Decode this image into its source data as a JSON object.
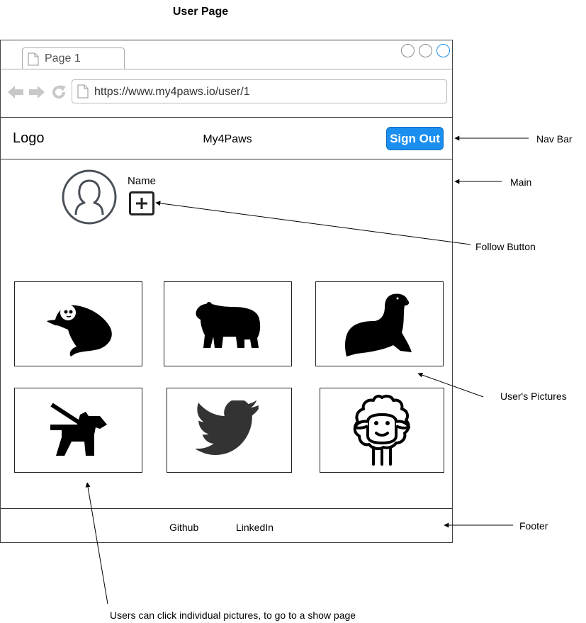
{
  "page_title": "User Page",
  "browser": {
    "tab_label": "Page 1",
    "url": "https://www.my4paws.io/user/1"
  },
  "navbar": {
    "logo": "Logo",
    "brand": "My4Paws",
    "sign_out": "Sign Out",
    "accent_color": "#1b8ff0"
  },
  "profile": {
    "name_label": "Name",
    "follow_icon": "plus-square-icon"
  },
  "pictures": [
    {
      "icon": "sloth-icon"
    },
    {
      "icon": "bear-icon"
    },
    {
      "icon": "seal-icon"
    },
    {
      "icon": "dog-walking-icon"
    },
    {
      "icon": "twitter-bird-icon"
    },
    {
      "icon": "sheep-icon"
    }
  ],
  "footer": {
    "links": [
      "Github",
      "LinkedIn"
    ]
  },
  "annotations": {
    "nav_bar": "Nav Bar",
    "main": "Main",
    "follow_button": "Follow Button",
    "users_pictures": "User's Pictures",
    "footer": "Footer",
    "click_note": "Users can click individual pictures, to go to a show page"
  }
}
